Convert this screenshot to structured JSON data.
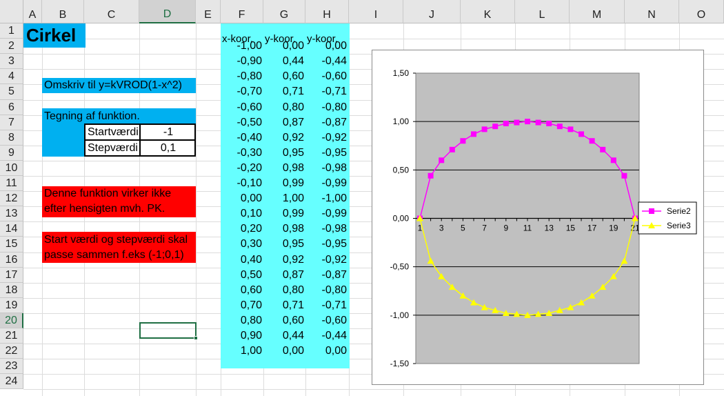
{
  "columns": [
    "A",
    "B",
    "C",
    "D",
    "E",
    "F",
    "G",
    "H",
    "I",
    "J",
    "K",
    "L",
    "M",
    "N",
    "O"
  ],
  "rows": [
    "1",
    "2",
    "3",
    "4",
    "5",
    "6",
    "7",
    "8",
    "9",
    "10",
    "11",
    "12",
    "13",
    "14",
    "15",
    "16",
    "17",
    "18",
    "19",
    "20",
    "21",
    "22",
    "23",
    "24"
  ],
  "selected_cell": {
    "column": "D",
    "row": "20"
  },
  "colors": {
    "cyan_label": "#00b0f0",
    "light_cyan": "#66ffff",
    "red": "#ff0000",
    "plot_area": "#c0c0c0",
    "serie2": "#ff00ff",
    "serie3": "#ffff00",
    "selection": "#1e6e42"
  },
  "sheet": {
    "title": "Cirkel",
    "rewrite_note": "Omskriv til y=kVROD(1-x^2)",
    "drawing_label": "Tegning af funktion.",
    "start_label": "Startværdi",
    "start_value": "-1",
    "step_label": "Stepværdi",
    "step_value": "0,1",
    "warning_line1": "Denne funktion virker ikke",
    "warning_line2": "efter hensigten mvh. PK.",
    "note_line1": "Start værdi og stepværdi skal",
    "note_line2": "passe sammen f.eks (-1;0,1)"
  },
  "table": {
    "headers": [
      "x-koor.",
      "y-koor.",
      "y-koor."
    ],
    "rows": [
      [
        "-1,00",
        "0,00",
        "0,00"
      ],
      [
        "-0,90",
        "0,44",
        "-0,44"
      ],
      [
        "-0,80",
        "0,60",
        "-0,60"
      ],
      [
        "-0,70",
        "0,71",
        "-0,71"
      ],
      [
        "-0,60",
        "0,80",
        "-0,80"
      ],
      [
        "-0,50",
        "0,87",
        "-0,87"
      ],
      [
        "-0,40",
        "0,92",
        "-0,92"
      ],
      [
        "-0,30",
        "0,95",
        "-0,95"
      ],
      [
        "-0,20",
        "0,98",
        "-0,98"
      ],
      [
        "-0,10",
        "0,99",
        "-0,99"
      ],
      [
        "0,00",
        "1,00",
        "-1,00"
      ],
      [
        "0,10",
        "0,99",
        "-0,99"
      ],
      [
        "0,20",
        "0,98",
        "-0,98"
      ],
      [
        "0,30",
        "0,95",
        "-0,95"
      ],
      [
        "0,40",
        "0,92",
        "-0,92"
      ],
      [
        "0,50",
        "0,87",
        "-0,87"
      ],
      [
        "0,60",
        "0,80",
        "-0,80"
      ],
      [
        "0,70",
        "0,71",
        "-0,71"
      ],
      [
        "0,80",
        "0,60",
        "-0,60"
      ],
      [
        "0,90",
        "0,44",
        "-0,44"
      ],
      [
        "1,00",
        "0,00",
        "0,00"
      ]
    ]
  },
  "chart_data": {
    "type": "line",
    "x": [
      1,
      2,
      3,
      4,
      5,
      6,
      7,
      8,
      9,
      10,
      11,
      12,
      13,
      14,
      15,
      16,
      17,
      18,
      19,
      20,
      21
    ],
    "x_tick_labels": [
      "1",
      "3",
      "5",
      "7",
      "9",
      "11",
      "13",
      "15",
      "17",
      "19",
      "21"
    ],
    "y_tick_labels": [
      "1,50",
      "1,00",
      "0,50",
      "0,00",
      "-0,50",
      "-1,00",
      "-1,50"
    ],
    "ylim": [
      -1.5,
      1.5
    ],
    "grid": true,
    "legend": "right",
    "series": [
      {
        "name": "Serie2",
        "color": "#ff00ff",
        "marker": "square",
        "values": [
          0,
          0.44,
          0.6,
          0.71,
          0.8,
          0.87,
          0.92,
          0.95,
          0.98,
          0.99,
          1,
          0.99,
          0.98,
          0.95,
          0.92,
          0.87,
          0.8,
          0.71,
          0.6,
          0.44,
          0
        ]
      },
      {
        "name": "Serie3",
        "color": "#ffff00",
        "marker": "triangle",
        "values": [
          0,
          -0.44,
          -0.6,
          -0.71,
          -0.8,
          -0.87,
          -0.92,
          -0.95,
          -0.98,
          -0.99,
          -1,
          -0.99,
          -0.98,
          -0.95,
          -0.92,
          -0.87,
          -0.8,
          -0.71,
          -0.6,
          -0.44,
          0
        ]
      }
    ]
  }
}
